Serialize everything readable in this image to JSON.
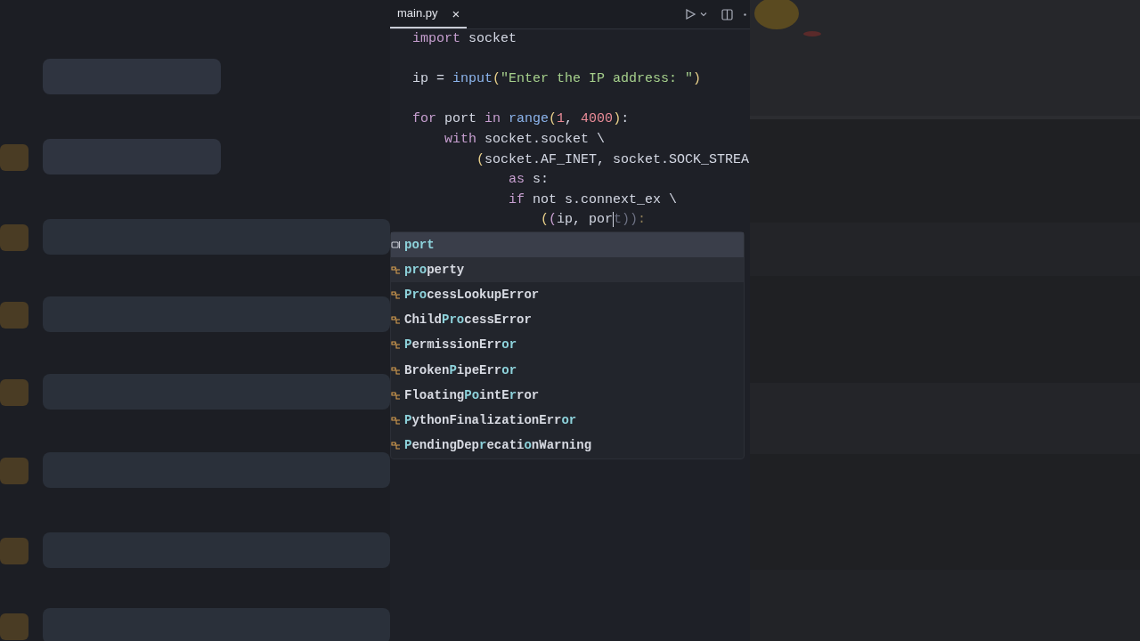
{
  "tab": {
    "title": "main.py",
    "close": "×",
    "selected": true
  },
  "code": [
    {
      "kind": "code",
      "tokens": [
        {
          "kind": "kw",
          "text": "import"
        },
        {
          "kind": "plain",
          "text": " socket"
        }
      ]
    },
    {
      "kind": "blank"
    },
    {
      "kind": "code",
      "tokens": [
        {
          "kind": "plain",
          "text": "ip = "
        },
        {
          "kind": "fn",
          "text": "input"
        },
        {
          "kind": "paren",
          "text": "("
        },
        {
          "kind": "str",
          "text": "\"Enter the IP address: \""
        },
        {
          "kind": "paren",
          "text": ")"
        }
      ]
    },
    {
      "kind": "blank"
    },
    {
      "kind": "code",
      "tokens": [
        {
          "kind": "kw",
          "text": "for"
        },
        {
          "kind": "plain",
          "text": " port "
        },
        {
          "kind": "kw",
          "text": "in"
        },
        {
          "kind": "fn",
          "text": " range"
        },
        {
          "kind": "paren",
          "text": "("
        },
        {
          "kind": "num",
          "text": "1"
        },
        {
          "kind": "plain",
          "text": ", "
        },
        {
          "kind": "num",
          "text": "4000"
        },
        {
          "kind": "paren",
          "text": ")"
        },
        {
          "kind": "plain",
          "text": ":"
        }
      ]
    },
    {
      "kind": "code",
      "tokens": [
        {
          "kind": "kw",
          "text": "    with"
        },
        {
          "kind": "plain",
          "text": " socket.socket \\"
        }
      ]
    },
    {
      "kind": "code",
      "tokens": [
        {
          "kind": "paren",
          "text": "        ("
        },
        {
          "kind": "plain",
          "text": "socket.AF_INET, socket.SOCK_STREA"
        }
      ]
    },
    {
      "kind": "code",
      "tokens": [
        {
          "kind": "kw",
          "text": "            as"
        },
        {
          "kind": "plain",
          "text": " s:"
        }
      ]
    },
    {
      "kind": "code",
      "tokens": [
        {
          "kind": "kw",
          "text": "            if"
        },
        {
          "kind": "plain",
          "text": " not s.connext_ex \\"
        }
      ]
    },
    {
      "kind": "code",
      "tokens": [
        {
          "kind": "paren",
          "text": "                ("
        },
        {
          "kind": "kw",
          "text": "("
        },
        {
          "kind": "plain",
          "text": "ip, por"
        },
        {
          "kind": "cursor"
        },
        {
          "kind": "ghost",
          "text": "t))"
        },
        {
          "kind": "ghostpunct",
          "text": ":"
        }
      ]
    }
  ],
  "completions": [
    {
      "kind": "variable",
      "selected": true,
      "parts": [
        {
          "text": "port",
          "match": true
        }
      ]
    },
    {
      "kind": "class",
      "selected": false,
      "parts": [
        {
          "text": "pro",
          "match": true
        },
        {
          "text": "perty",
          "match": false
        }
      ]
    },
    {
      "kind": "class",
      "selected": false,
      "parts": [
        {
          "text": "Pro",
          "match": true
        },
        {
          "text": "cessLookupError",
          "match": false
        }
      ]
    },
    {
      "kind": "class",
      "selected": false,
      "parts": [
        {
          "text": "Child",
          "match": false
        },
        {
          "text": "Pro",
          "match": true
        },
        {
          "text": "cessError",
          "match": false
        }
      ]
    },
    {
      "kind": "class",
      "selected": false,
      "parts": [
        {
          "text": "P",
          "match": true
        },
        {
          "text": "ermissionErr",
          "match": false
        },
        {
          "text": "or",
          "match": true
        }
      ]
    },
    {
      "kind": "class",
      "selected": false,
      "parts": [
        {
          "text": "Broken",
          "match": false
        },
        {
          "text": "P",
          "match": true
        },
        {
          "text": "ipeErr",
          "match": false
        },
        {
          "text": "or",
          "match": true
        }
      ]
    },
    {
      "kind": "class",
      "selected": false,
      "parts": [
        {
          "text": "Floating",
          "match": false
        },
        {
          "text": "P",
          "match": true
        },
        {
          "text": "o",
          "match": true
        },
        {
          "text": "intE",
          "match": false
        },
        {
          "text": "r",
          "match": true
        },
        {
          "text": "ror",
          "match": false
        }
      ]
    },
    {
      "kind": "class",
      "selected": false,
      "parts": [
        {
          "text": "P",
          "match": true
        },
        {
          "text": "ythonFinalizationErr",
          "match": false
        },
        {
          "text": "or",
          "match": true
        }
      ]
    },
    {
      "kind": "class",
      "selected": false,
      "parts": [
        {
          "text": "P",
          "match": true
        },
        {
          "text": "endingDep",
          "match": false
        },
        {
          "text": "r",
          "match": true
        },
        {
          "text": "ecati",
          "match": false
        },
        {
          "text": "o",
          "match": true
        },
        {
          "text": "nWarning",
          "match": false
        }
      ]
    }
  ]
}
